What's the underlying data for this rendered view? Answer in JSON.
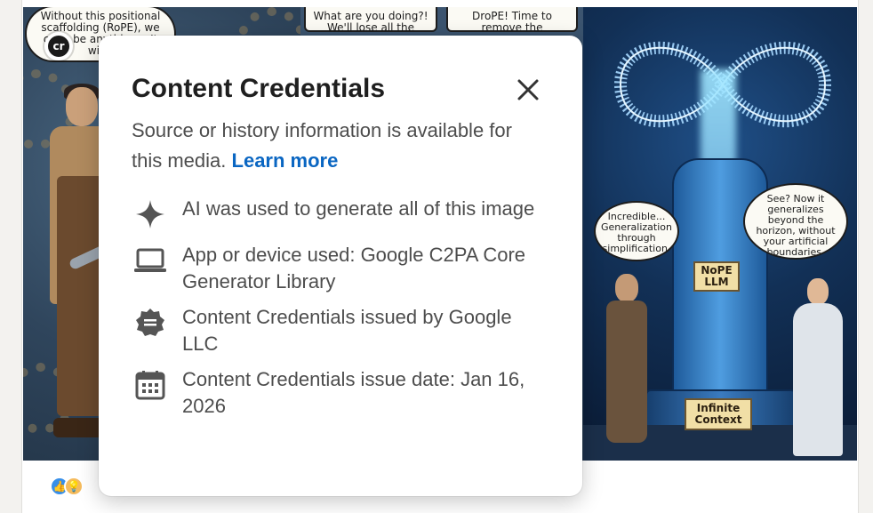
{
  "comic": {
    "bubble_left": "Without this positional scaffolding (RoPE), we can't be anything... It will t",
    "bubble_mid": "What are you doing?! We'll lose all the",
    "bubble_mid2": "DroPE! Time to remove the scaffolding. Let",
    "bubble_right_left": "Incredible... Generalization through simplification.",
    "bubble_right_right": "See? Now it generalizes beyond the horizon, without your artificial boundaries.",
    "sign_nope": "NoPE LLM",
    "sign_context": "Infinite Context"
  },
  "cr_badge": {
    "label": "cr"
  },
  "popover": {
    "title": "Content Credentials",
    "description": "Source or history information is available for this media.",
    "learn_more": "Learn more",
    "items": [
      {
        "icon": "sparkle-icon",
        "text": "AI was used to generate all of this image"
      },
      {
        "icon": "laptop-icon",
        "text": "App or device used: Google C2PA Core Generator Library"
      },
      {
        "icon": "verified-badge-icon",
        "text": "Content Credentials issued by Google LLC"
      },
      {
        "icon": "calendar-icon",
        "text": "Content Credentials issue date: Jan 16, 2026"
      }
    ]
  },
  "reactions": [
    {
      "icon": "like-icon",
      "color": "#378fe9"
    },
    {
      "icon": "insightful-icon",
      "color": "#f5bb5c"
    }
  ]
}
